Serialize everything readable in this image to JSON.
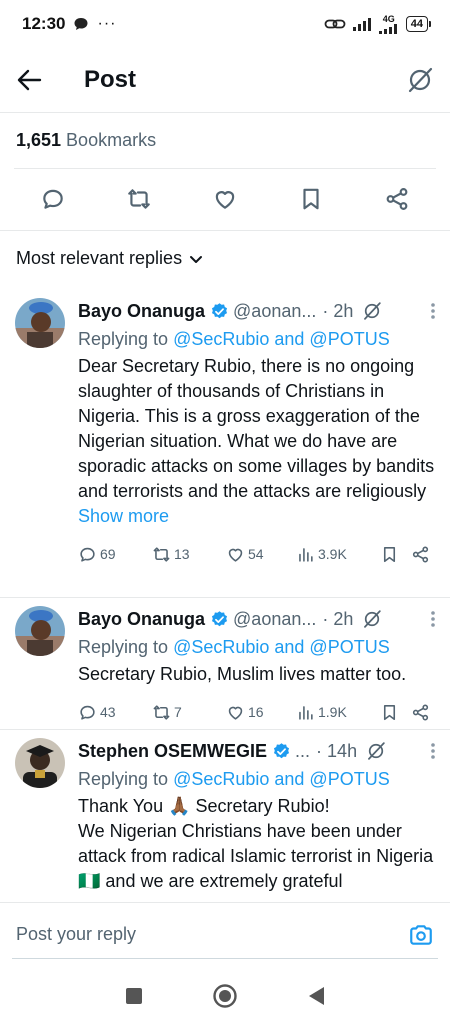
{
  "status": {
    "time": "12:30",
    "network": "4G",
    "battery": "44"
  },
  "header": {
    "title": "Post"
  },
  "post": {
    "bookmark_count": "1,651",
    "bookmark_label": " Bookmarks"
  },
  "replies_filter": {
    "label": "Most relevant replies"
  },
  "replies": [
    {
      "name": "Bayo Onanuga",
      "handle": "@aonan...",
      "time": "· 2h",
      "replying_prefix": "Replying to ",
      "replying_mentions": "@SecRubio and @POTUS",
      "text": "Dear Secretary Rubio, there is no ongoing slaughter of thousands of Christians in Nigeria. This is a gross exaggeration of the Nigerian situation. What we do have are sporadic attacks on some villages by bandits and terrorists and the attacks are religiously ",
      "show_more": "Show more",
      "replies_count": "69",
      "reposts": "13",
      "likes": "54",
      "views": "3.9K"
    },
    {
      "name": "Bayo Onanuga",
      "handle": "@aonan...",
      "time": "· 2h",
      "replying_prefix": "Replying to ",
      "replying_mentions": "@SecRubio and @POTUS",
      "text": "Secretary Rubio, Muslim lives matter too.",
      "replies_count": "43",
      "reposts": "7",
      "likes": "16",
      "views": "1.9K"
    },
    {
      "name": "Stephen OSEMWEGIE",
      "handle": "...",
      "time": "· 14h",
      "replying_prefix": "Replying to ",
      "replying_mentions": "@SecRubio and @POTUS",
      "text_line1_a": "Thank You ",
      "text_line1_emoji": "🙏🏾",
      "text_line1_b": " Secretary Rubio!",
      "text_line2": "We Nigerian Christians have been under attack from radical Islamic terrorist in Nigeria ",
      "text_line2_flag": "🇳🇬",
      "text_line2_end": " and we are extremely grateful"
    }
  ],
  "compose": {
    "placeholder": "Post your reply"
  },
  "colors": {
    "accent": "#1d9bf0",
    "muted": "#536471",
    "text": "#0f1419",
    "divider": "#e7e9ea"
  }
}
